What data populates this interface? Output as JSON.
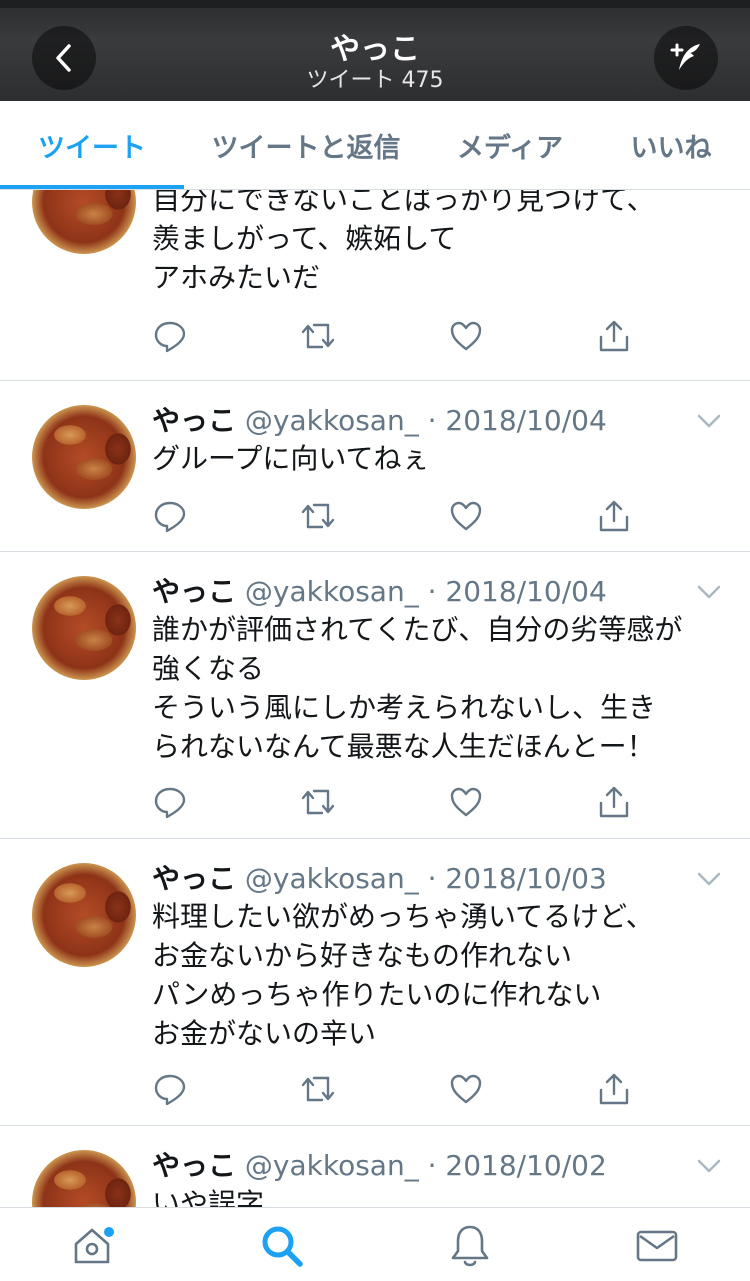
{
  "header": {
    "title": "やっこ",
    "subtitle": "ツイート 475"
  },
  "tabs": [
    {
      "label": "ツイート",
      "active": true
    },
    {
      "label": "ツイートと返信",
      "active": false
    },
    {
      "label": "メディア",
      "active": false
    },
    {
      "label": "いいね",
      "active": false
    }
  ],
  "tweets": [
    {
      "name": "",
      "handle": "",
      "date": "",
      "lines": [
        "自分にできないことばっかり見つけて、",
        "羨ましがって、嫉妬して",
        "アホみたいだ"
      ]
    },
    {
      "name": "やっこ",
      "handle": "@yakkosan_",
      "date": "· 2018/10/04",
      "lines": [
        "グループに向いてねぇ"
      ]
    },
    {
      "name": "やっこ",
      "handle": "@yakkosan_",
      "date": "· 2018/10/04",
      "lines": [
        "誰かが評価されてくたび、自分の劣等感が",
        "強くなる",
        "そういう風にしか考えられないし、生き",
        "られないなんて最悪な人生だほんとー！"
      ]
    },
    {
      "name": "やっこ",
      "handle": "@yakkosan_",
      "date": "· 2018/10/03",
      "lines": [
        "料理したい欲がめっちゃ湧いてるけど、",
        "お金ないから好きなもの作れない",
        "パンめっちゃ作りたいのに作れない",
        "お金がないの辛い"
      ]
    },
    {
      "name": "やっこ",
      "handle": "@yakkosan_",
      "date": "· 2018/10/02",
      "lines": [
        "いや誤字"
      ]
    }
  ],
  "icons": {
    "back": "chevron-left-icon",
    "compose": "compose-tweet-icon",
    "reply": "reply-icon",
    "retweet": "retweet-icon",
    "like": "heart-icon",
    "share": "share-icon",
    "home": "home-icon",
    "search": "search-icon",
    "notifications": "bell-icon",
    "messages": "envelope-icon"
  },
  "colors": {
    "accent": "#1da1f2",
    "secondary_text": "#657786",
    "header_bg": "#333436"
  }
}
